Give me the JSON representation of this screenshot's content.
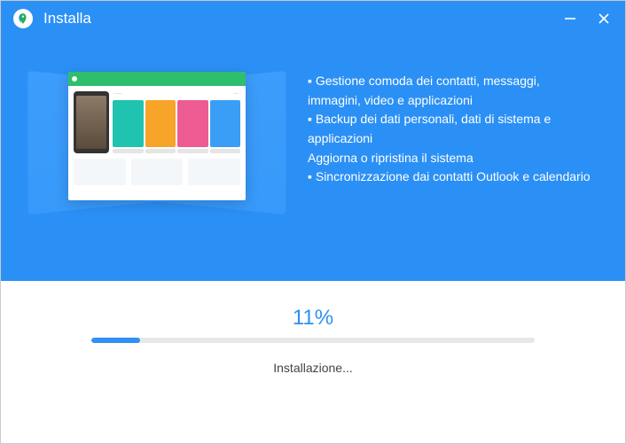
{
  "header": {
    "title": "Installa"
  },
  "features": {
    "line1": "▪ Gestione comoda dei contatti, messaggi, immagini, video e applicazioni",
    "line2": "▪ Backup dei dati personali, dati di sistema e applicazioni",
    "line3": "Aggiorna o ripristina il sistema",
    "line4": "▪ Sincronizzazione dai contatti Outlook e calendario"
  },
  "progress": {
    "percent_label": "11%",
    "percent_value": 11,
    "status": "Installazione..."
  },
  "colors": {
    "accent": "#2b90f6",
    "bar_fill": "#2e91f3"
  }
}
